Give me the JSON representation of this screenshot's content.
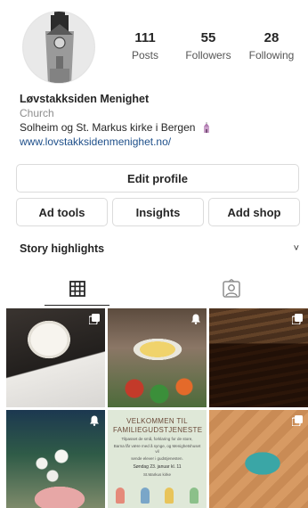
{
  "profile": {
    "name": "Løvstakksiden Menighet",
    "category": "Church",
    "bio": "Solheim og St. Markus kirke i Bergen",
    "link": "www.lovstakksidenmenighet.no/"
  },
  "stats": {
    "posts": {
      "value": "111",
      "label": "Posts"
    },
    "followers": {
      "value": "55",
      "label": "Followers"
    },
    "following": {
      "value": "28",
      "label": "Following"
    }
  },
  "buttons": {
    "edit_profile": "Edit profile",
    "ad_tools": "Ad tools",
    "insights": "Insights",
    "add_shop": "Add shop"
  },
  "highlights": {
    "label": "Story highlights",
    "chevron": "˅"
  },
  "tabs": [
    {
      "icon": "grid-icon",
      "active": true
    },
    {
      "icon": "tagged-person-icon",
      "active": false
    }
  ],
  "posts": [
    {
      "badge": "multiple-photos-icon"
    },
    {
      "badge": "notification-bell-icon"
    },
    {
      "badge": "multiple-photos-icon"
    },
    {
      "badge": "notification-bell-icon"
    },
    {
      "title": "VELKOMMEN TIL FAMILIEGUDSTJENESTE",
      "lines": [
        "Tilpasset de små, forklaring for de store,",
        "Barna får være med å synge, og Menighetshuset vil",
        "sende elever i gudstjenesten."
      ],
      "date": "Søndag 23. januar kl. 11",
      "place": "St.Markus kirke"
    },
    {
      "badge": "multiple-photos-icon"
    }
  ],
  "colors": {
    "text": "#262626",
    "muted": "#8e8e8e",
    "link": "#1e4f8a",
    "border": "#dbdbdb"
  }
}
